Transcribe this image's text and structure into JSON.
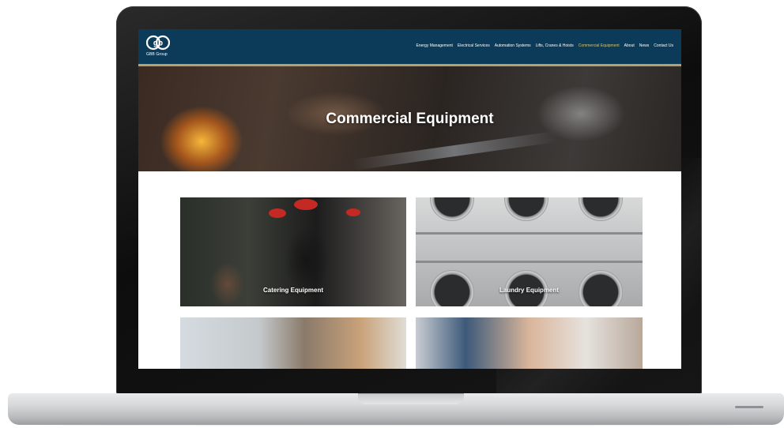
{
  "brand": {
    "logo_text": "gb",
    "company_name": "GBB Group"
  },
  "nav": {
    "items": [
      "Energy Management",
      "Electrical Services",
      "Automation Systems",
      "Lifts, Cranes & Hoists",
      "Commercial Equipment",
      "About",
      "News",
      "Contact Us"
    ],
    "active_index": 4
  },
  "hero": {
    "title": "Commercial Equipment"
  },
  "cards": [
    {
      "label": "Catering Equipment"
    },
    {
      "label": "Laundry Equipment"
    }
  ],
  "colors": {
    "navbar": "#0c3b5a",
    "accent": "#d8c267",
    "navbar_border": "#b5a16a"
  }
}
